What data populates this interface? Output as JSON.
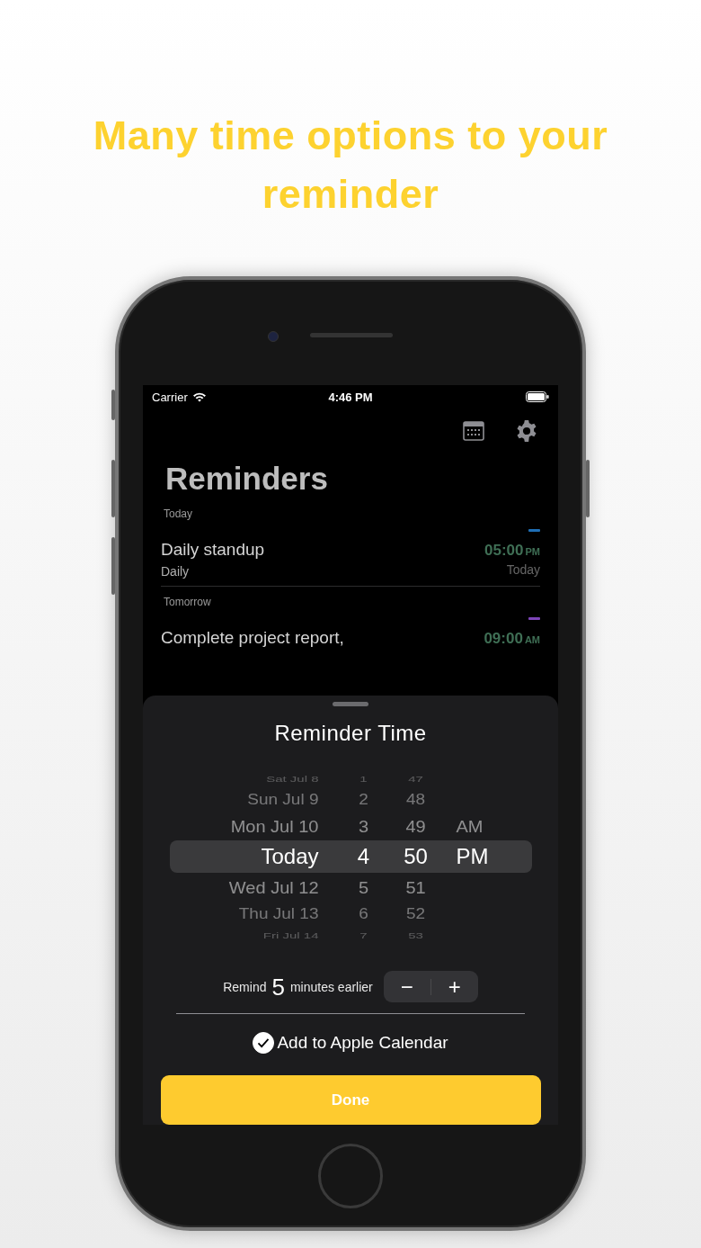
{
  "headline": "Many time options to your reminder",
  "status_bar": {
    "carrier": "Carrier",
    "time": "4:46 PM"
  },
  "title": "Reminders",
  "sections": [
    {
      "label": "Today",
      "items": [
        {
          "title": "Daily standup",
          "subtitle": "Daily",
          "time": "05:00",
          "meridiem": "PM",
          "date": "Today",
          "color": "#1f6fb5"
        }
      ]
    },
    {
      "label": "Tomorrow",
      "items": [
        {
          "title": "Complete project report,",
          "time": "09:00",
          "meridiem": "AM",
          "color": "#7e45b8"
        }
      ]
    }
  ],
  "sheet": {
    "title": "Reminder Time",
    "picker": {
      "rows": [
        {
          "date": "Sat Jul 8",
          "hour": "1",
          "minute": "47",
          "selected": false
        },
        {
          "date": "Sun Jul 9",
          "hour": "2",
          "minute": "48",
          "selected": false
        },
        {
          "date": "Mon Jul 10",
          "hour": "3",
          "minute": "49",
          "meridiem": "AM",
          "selected": false
        },
        {
          "date": "Today",
          "hour": "4",
          "minute": "50",
          "meridiem": "PM",
          "selected": true
        },
        {
          "date": "Wed Jul 12",
          "hour": "5",
          "minute": "51",
          "selected": false
        },
        {
          "date": "Thu Jul 13",
          "hour": "6",
          "minute": "52",
          "selected": false
        },
        {
          "date": "Fri Jul 14",
          "hour": "7",
          "minute": "53",
          "selected": false
        }
      ]
    },
    "remind": {
      "prefix": "Remind",
      "value": "5",
      "suffix": "minutes earlier",
      "minus": "−",
      "plus": "+"
    },
    "calendar": {
      "label": "Add to Apple Calendar",
      "checked": true
    },
    "done": "Done"
  }
}
